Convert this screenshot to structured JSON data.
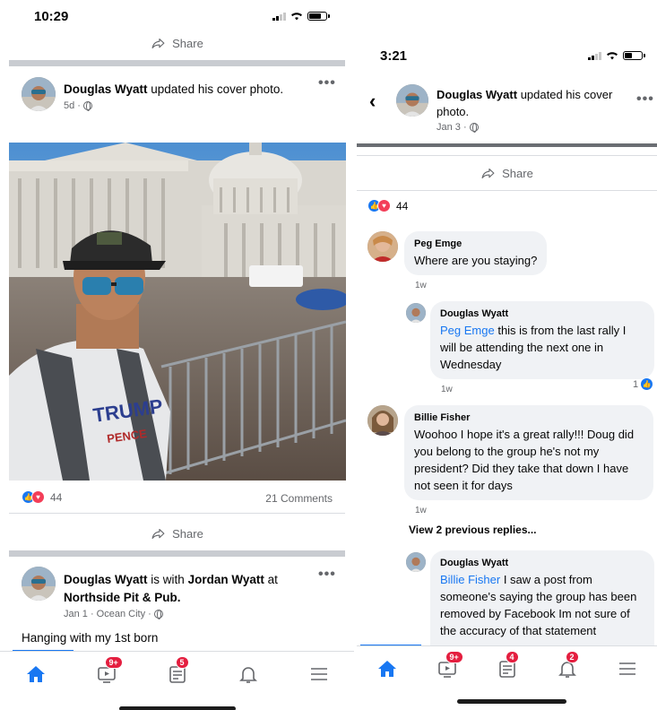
{
  "left_phone": {
    "status": {
      "time": "10:29"
    },
    "top_share_label": "Share",
    "post1": {
      "author": "Douglas Wyatt",
      "action": "updated his cover photo.",
      "time": "5d ·",
      "reactions_count": "44",
      "comments_count": "21 Comments",
      "share_label": "Share",
      "photo_shirt_text_1": "TRUMP",
      "photo_shirt_text_2": "PENCE"
    },
    "post2": {
      "author": "Douglas Wyatt",
      "with_text": "is with",
      "tagged": "Jordan Wyatt",
      "at_text": "at",
      "place": "Northside Pit & Pub.",
      "time": "Jan 1 · Ocean City ·",
      "caption": "Hanging with my 1st born"
    },
    "tabbar": {
      "video_badge": "9+",
      "feed_badge": "5"
    }
  },
  "right_phone": {
    "status": {
      "time": "3:21"
    },
    "header": {
      "author": "Douglas Wyatt",
      "action": "updated his cover photo.",
      "time": "Jan 3 ·"
    },
    "share_label": "Share",
    "reactions_count": "44",
    "comments": [
      {
        "name": "Peg Emge",
        "text": "Where are you staying?",
        "time": "1w"
      },
      {
        "name": "Douglas Wyatt",
        "mention": "Peg Emge",
        "text": "this is from the last rally I will be attending the next one in Wednesday",
        "time": "1w",
        "likes": "1"
      },
      {
        "name": "Billie Fisher",
        "text": "Woohoo I hope it's a great rally!!! Doug did you belong to the group he's not my president? Did they take that down I have not seen it for days",
        "time": "1w"
      },
      {
        "name": "Douglas Wyatt",
        "mention": "Billie Fisher",
        "text": "I saw a post from someone's saying the group has been removed by Facebook Im not sure of the accuracy of that statement"
      }
    ],
    "view_previous": "View 2 previous replies...",
    "tabbar": {
      "video_badge": "9+",
      "feed_badge": "4",
      "notif_badge": "2"
    }
  },
  "colors": {
    "facebook_blue": "#1877f2",
    "badge_red": "#e41e3f",
    "bubble_gray": "#f0f2f5"
  }
}
